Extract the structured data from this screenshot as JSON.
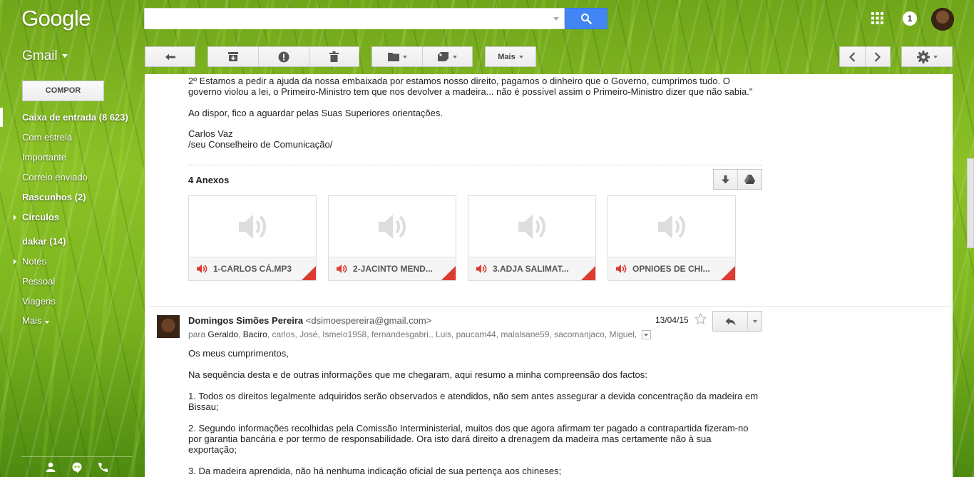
{
  "header": {
    "logo_text": "Google",
    "search_value": "",
    "notification_count": "1",
    "app_switcher_label": "Gmail"
  },
  "toolbar": {
    "more_label": "Mais"
  },
  "sidebar": {
    "compose_label": "COMPOR",
    "items": [
      {
        "label": "Caixa de entrada (8 623)",
        "bold": true,
        "active": true
      },
      {
        "label": "Com estrela",
        "bold": false
      },
      {
        "label": "Importante",
        "bold": false
      },
      {
        "label": "Correio enviado",
        "bold": false
      },
      {
        "label": "Rascunhos (2)",
        "bold": true
      },
      {
        "label": "Círculos",
        "bold": true,
        "expandable": true
      },
      {
        "label": "dakar (14)",
        "bold": true
      },
      {
        "label": "Notes",
        "bold": false,
        "expandable": true
      },
      {
        "label": "Pessoal",
        "bold": false
      },
      {
        "label": "Viagens",
        "bold": false
      },
      {
        "label": "Mais",
        "bold": false,
        "dropdown": true
      }
    ]
  },
  "prev_message": {
    "lines": [
      "2º Estamos a pedir a ajuda da nossa embaixada por estamos nosso direito, pagamos o dinheiro que o Governo, cumprimos tudo. O",
      "governo violou a lei, o Primeiro-Ministro  tem que nos devolver a madeira... não é possível assim o Primeiro-Ministro dizer que não sabia.\"",
      "Ao dispor, fico a aguardar pelas Suas Superiores orientações.",
      "Carlos Vaz",
      "/seu Conselheiro de Comunicação/"
    ],
    "attachments_title": "4 Anexos",
    "attachments": [
      {
        "name": "1-CARLOS CÁ.MP3"
      },
      {
        "name": "2-JACINTO MEND..."
      },
      {
        "name": "3.ADJA SALIMAT..."
      },
      {
        "name": "OPNIOES DE CHI..."
      }
    ]
  },
  "message": {
    "sender_name": "Domingos Simões Pereira",
    "sender_email": "<dsimoespereira@gmail.com>",
    "date": "13/04/15",
    "to_prefix": "para",
    "recipients": [
      "Geraldo",
      "Baciro",
      "carlos",
      "José",
      "Ismelo1958",
      "fernandesgabri.",
      "Luis",
      "paucam44",
      "malalsane59",
      "sacomanjaco",
      "Miguel"
    ],
    "body": [
      "Os meus cumprimentos,",
      "Na sequência desta e  de outras informações que me chegaram, aqui resumo a minha compreensão dos factos:",
      "1. Todos os direitos legalmente adquiridos serão observados e atendidos, não sem antes assegurar a devida concentração da madeira em",
      "Bissau;",
      "2. Segundo informações recolhidas pela Comissão Interministerial, muitos dos que agora afirmam ter pagado a contrapartida fizeram-no",
      "por garantia bancária e por termo de responsabilidade. Ora isto dará direito a drenagem da madeira mas certamente não à sua",
      "exportação;",
      "3. Da madeira aprendida, não há nenhuma indicação oficial de sua pertença aos chineses;"
    ]
  },
  "colors": {
    "search_blue": "#4285f4",
    "attachment_red": "#dd3b2f"
  }
}
